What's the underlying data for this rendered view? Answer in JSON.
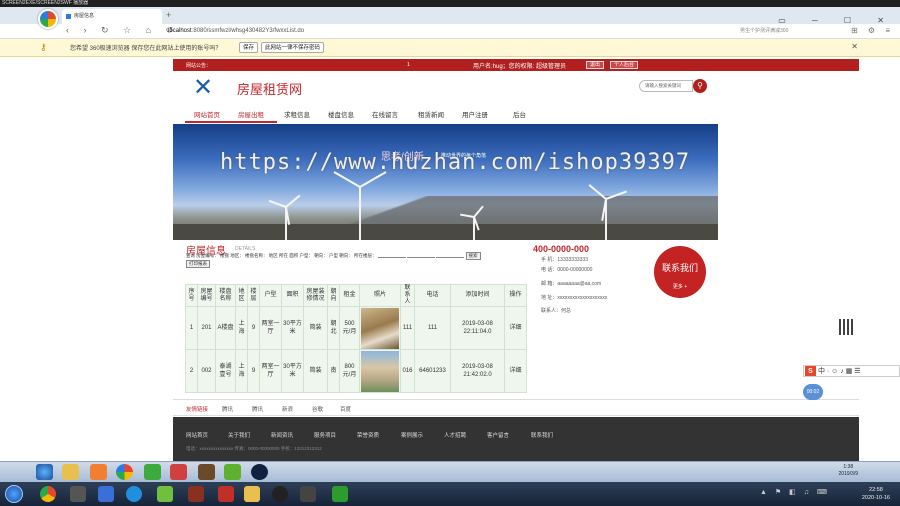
{
  "player_title": "SCREEN2EXE/SCREEN2SWF 播放器",
  "browser": {
    "tab_title": "房屋信息",
    "tab_new": "+",
    "url_host": "localhost",
    "url_path": ":8080/ssmfwzl/whsg430482Y3/fwxxList.do",
    "search_hint": "男生个护测评满减300",
    "nav_icons": "‹ › ↻ ☆ ⌂ ↺",
    "right_icons": "⊞ ⚙ ≡",
    "win_ctrls": "▭ ─ ☐ ✕"
  },
  "password_bar": {
    "message": "您希望 360极速浏览器 保存您在此网站上使用的账号吗？",
    "save_label": "保存",
    "never_label": "此网站一律不保存密码",
    "close": "✕"
  },
  "site": {
    "topbar": {
      "notice": "网站公告：",
      "num": "1",
      "user": "用户名:hug；您的权限: 超级管理员",
      "btn_logout": "退出",
      "btn_center": "个人后台"
    },
    "logo_glyph": "✕",
    "name": "房屋租赁网",
    "search_placeholder": "请输入搜索关键词",
    "search_icon": "⚲",
    "nav": [
      "网站首页",
      "房屋出租",
      "求租信息",
      "楼盘信息",
      "在线留言",
      "租赁新闻",
      "用户注册",
      "后台"
    ],
    "banner_slogan": "思考/创新",
    "banner_slogan2": "推动世界的每个角落",
    "watermark": "https://www.huzhan.com/ishop39397"
  },
  "section": {
    "title": "房屋信息",
    "subtitle": "DETAILS",
    "filter_text": "查询 房屋编号：  楼盘  地区：  楼盘名称：  地区  所在  面积  户型：  朝向：  户型  朝向：  所在楼层：  ",
    "filter_btn": "搜索",
    "extra_btn": "打印报表"
  },
  "table": {
    "headers": [
      "序号",
      "房屋编号",
      "楼盘名称",
      "地区",
      "楼层",
      "户型",
      "面积",
      "房屋装修情况",
      "朝向",
      "租金",
      "照片",
      "联系人",
      "电话",
      "添加时间",
      "操作"
    ],
    "rows": [
      [
        "1",
        "201",
        "A楼盘",
        "上海",
        "9",
        "两室一厅",
        "30平方米",
        "简装",
        "朝北",
        "500元/月",
        "",
        "111",
        "111",
        "2019-03-08 22:11:04.0",
        "详细"
      ],
      [
        "2",
        "002",
        "泰湖壹号",
        "上海",
        "9",
        "两室一厅",
        "30平方米",
        "简装",
        "南",
        "800元/月",
        "",
        "016",
        "64601233",
        "2019-03-08 21:42:02.0",
        "详细"
      ]
    ]
  },
  "contact": {
    "phone": "400-0000-000",
    "lines": [
      "手  机：13333333333",
      "电  话：0000-00000000",
      "邮  箱：aaaaaaaa@aa.com",
      "地  址：xxxxxxxxxxxxxxxxxxxx",
      "联系人：何总"
    ],
    "circle_title": "联系我们",
    "circle_more": "更多 +"
  },
  "friend_links": {
    "label": "友情链接",
    "links": [
      "腾讯",
      "腾讯",
      "新浪",
      "谷歌",
      "百度"
    ]
  },
  "footer": {
    "links": [
      "网站首页",
      "关于我们",
      "新闻资讯",
      "服务项目",
      "荣誉资质",
      "案例展示",
      "人才招聘",
      "客户留言",
      "联系我们"
    ],
    "info": "电话：xxxxxxxxxxxxxxx    传真：0000-00000000    手机：13312312312"
  },
  "ime": {
    "s": "S",
    "icons": "中 · ☺ ♪ ▦ ☰"
  },
  "widget": "00:02",
  "inner_clock": {
    "time": "1:38",
    "date": "2019/3/9"
  },
  "outer_clock": {
    "time": "22:58",
    "date": "2020-10-16"
  },
  "tray": "▲ ⚑ ◧ ♫ ⌨",
  "colors": {
    "brand_red": "#c1272d",
    "topbar_red": "#b21f1f",
    "footer": "#333333"
  }
}
